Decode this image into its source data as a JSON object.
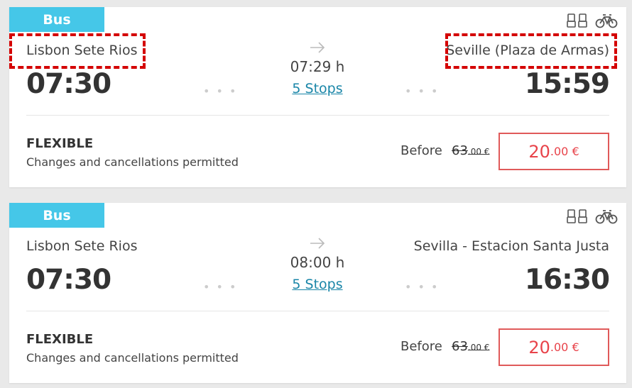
{
  "results": [
    {
      "badge": "Bus",
      "from": "Lisbon Sete Rios",
      "to": "Seville (Plaza de Armas)",
      "departure": "07:30",
      "arrival": "15:59",
      "duration": "07:29 h",
      "stops": "5 Stops",
      "fare_type": "FLEXIBLE",
      "fare_desc": "Changes and cancellations permitted",
      "before_label": "Before",
      "old_price_main": "63",
      "old_price_cents": ".00 €",
      "price_main": "20",
      "price_cents": ".00 €",
      "amenities": [
        "seat-icon",
        "bicycle-icon"
      ]
    },
    {
      "badge": "Bus",
      "from": "Lisbon Sete Rios",
      "to": "Sevilla - Estacion Santa Justa",
      "departure": "07:30",
      "arrival": "16:30",
      "duration": "08:00 h",
      "stops": "5 Stops",
      "fare_type": "FLEXIBLE",
      "fare_desc": "Changes and cancellations permitted",
      "before_label": "Before",
      "old_price_main": "63",
      "old_price_cents": ".00 €",
      "price_main": "20",
      "price_cents": ".00 €",
      "amenities": [
        "seat-icon",
        "bicycle-icon"
      ]
    }
  ],
  "colors": {
    "badge": "#45c7e8",
    "price": "#e8434a",
    "link": "#1a86a8",
    "highlight": "#d40000"
  }
}
